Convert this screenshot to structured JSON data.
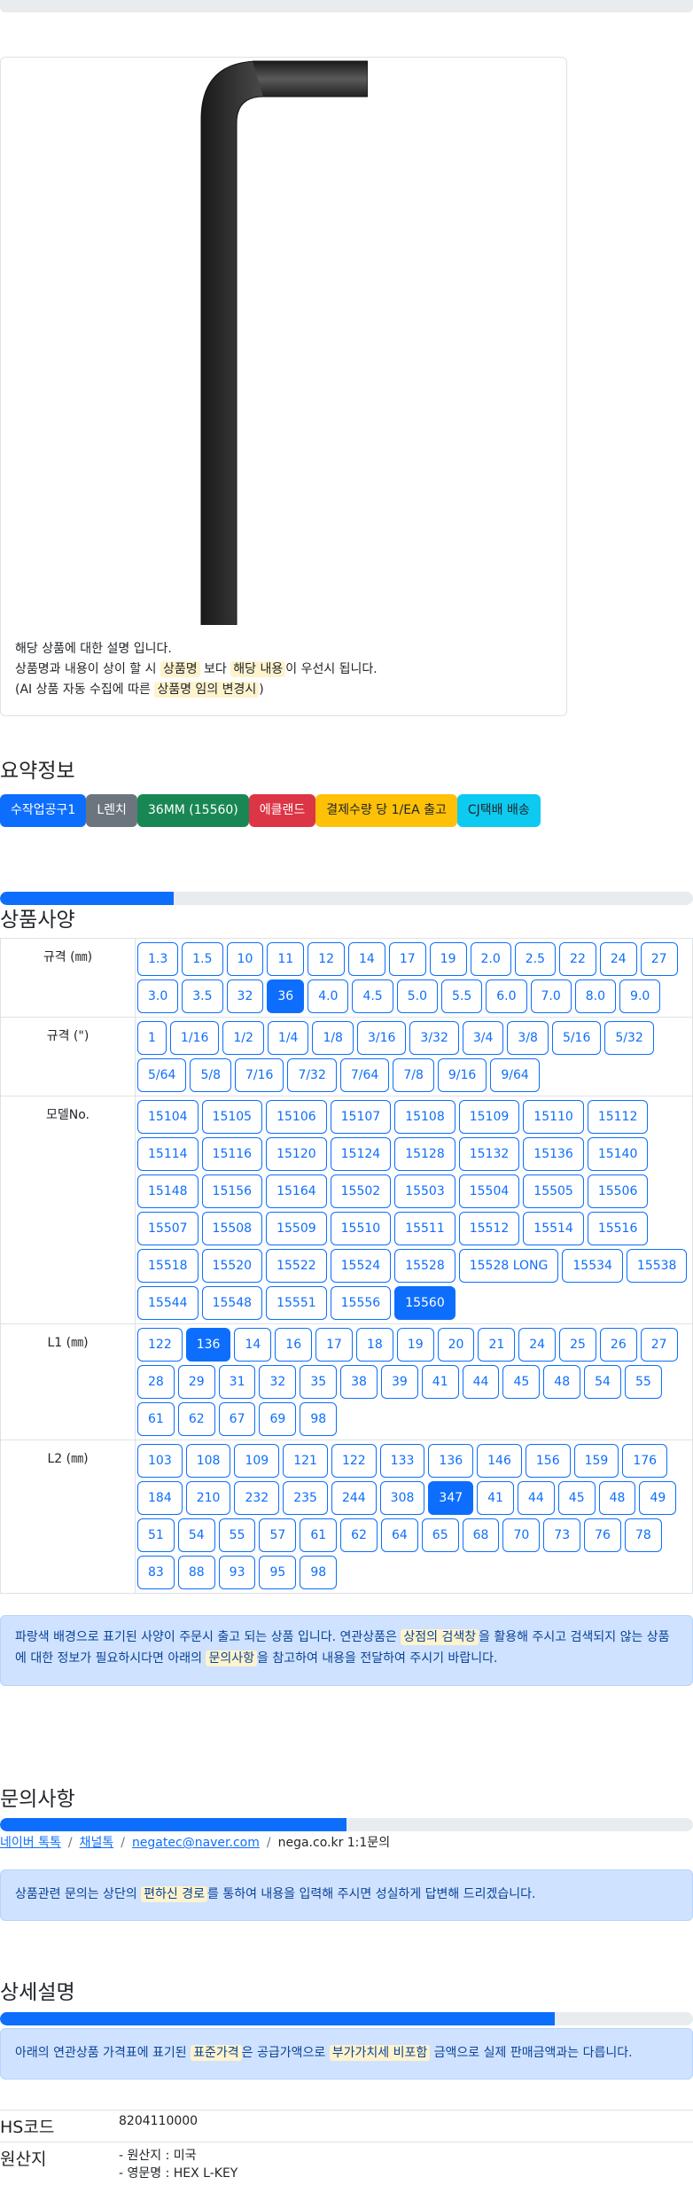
{
  "description": {
    "line1": "해당 상품에 대한 설명 입니다.",
    "line2_a": "상품명과 내용이 상이 할 시 ",
    "line2_hl1": "상품명",
    "line2_b": " 보다 ",
    "line2_hl2": "해당 내용",
    "line2_c": "이 우선시 됩니다.",
    "line3_a": "(AI 상품 자동 수집에 따른 ",
    "line3_hl": "상품명 임의 변경시",
    "line3_b": ")"
  },
  "summary": {
    "title": "요약정보",
    "badges": [
      {
        "label": "수작업공구1",
        "color": "#0d6efd",
        "text": "#ffffff"
      },
      {
        "label": "L렌치",
        "color": "#6c757d",
        "text": "#ffffff"
      },
      {
        "label": "36MM (15560)",
        "color": "#198754",
        "text": "#ffffff"
      },
      {
        "label": "에클랜드",
        "color": "#dc3545",
        "text": "#ffffff"
      },
      {
        "label": "결제수량 당 1/EA 출고",
        "color": "#ffc107",
        "text": "#212529"
      },
      {
        "label": "CJ택배 배송",
        "color": "#0dcaf0",
        "text": "#212529"
      }
    ]
  },
  "specs": {
    "title": "상품사양",
    "progress": 0.25,
    "rows": [
      {
        "label": "규격 (㎜)",
        "options": [
          "1.3",
          "1.5",
          "10",
          "11",
          "12",
          "14",
          "17",
          "19",
          "2.0",
          "2.5",
          "22",
          "24",
          "27",
          "3.0",
          "3.5",
          "32",
          "36",
          "4.0",
          "4.5",
          "5.0",
          "5.5",
          "6.0",
          "7.0",
          "8.0",
          "9.0"
        ],
        "selected": "36"
      },
      {
        "label": "규격 (\")",
        "options": [
          "1",
          "1/16",
          "1/2",
          "1/4",
          "1/8",
          "3/16",
          "3/32",
          "3/4",
          "3/8",
          "5/16",
          "5/32",
          "5/64",
          "5/8",
          "7/16",
          "7/32",
          "7/64",
          "7/8",
          "9/16",
          "9/64"
        ],
        "selected": ""
      },
      {
        "label": "모델No.",
        "options": [
          "15104",
          "15105",
          "15106",
          "15107",
          "15108",
          "15109",
          "15110",
          "15112",
          "15114",
          "15116",
          "15120",
          "15124",
          "15128",
          "15132",
          "15136",
          "15140",
          "15148",
          "15156",
          "15164",
          "15502",
          "15503",
          "15504",
          "15505",
          "15506",
          "15507",
          "15508",
          "15509",
          "15510",
          "15511",
          "15512",
          "15514",
          "15516",
          "15518",
          "15520",
          "15522",
          "15524",
          "15528",
          "15528 LONG",
          "15534",
          "15538",
          "15544",
          "15548",
          "15551",
          "15556",
          "15560"
        ],
        "selected": "15560"
      },
      {
        "label": "L1 (㎜)",
        "options": [
          "122",
          "136",
          "14",
          "16",
          "17",
          "18",
          "19",
          "20",
          "21",
          "24",
          "25",
          "26",
          "27",
          "28",
          "29",
          "31",
          "32",
          "35",
          "38",
          "39",
          "41",
          "44",
          "45",
          "48",
          "54",
          "55",
          "61",
          "62",
          "67",
          "69",
          "98"
        ],
        "selected": "136"
      },
      {
        "label": "L2 (㎜)",
        "options": [
          "103",
          "108",
          "109",
          "121",
          "122",
          "133",
          "136",
          "146",
          "156",
          "159",
          "176",
          "184",
          "210",
          "232",
          "235",
          "244",
          "308",
          "347",
          "41",
          "44",
          "45",
          "48",
          "49",
          "51",
          "54",
          "55",
          "57",
          "61",
          "62",
          "64",
          "65",
          "68",
          "70",
          "73",
          "76",
          "78",
          "83",
          "88",
          "93",
          "95",
          "98"
        ],
        "selected": "347"
      }
    ],
    "note_a": "파랑색 배경으로 표기된 사양이 주문시 출고 되는 상품 입니다. 연관상품은 ",
    "note_hl1": "상점의 검색창",
    "note_b": "을 활용해 주시고 검색되지 않는 상품에 대한 정보가 필요하시다면 아래의 ",
    "note_hl2": "문의사항",
    "note_c": "을 참고하여 내용을 전달하여 주시기 바랍니다."
  },
  "inquiry": {
    "title": "문의사항",
    "progress": 0.5,
    "links": [
      "네이버 톡톡",
      "채널톡",
      "negatec@naver.com"
    ],
    "plain": "nega.co.kr 1:1문의",
    "note_a": "상품관련 문의는 상단의 ",
    "note_hl": "편하신 경로",
    "note_b": "를 통하여 내용을 입력해 주시면 성실하게 답변해 드리겠습니다."
  },
  "detail": {
    "title": "상세설명",
    "progress": 0.8,
    "note_a": "아래의 연관상품 가격표에 표기된 ",
    "note_hl1": "표준가격",
    "note_b": "은 공급가액으로 ",
    "note_hl2": "부가가치세 비포함",
    "note_c": " 금액으로 실제 판매금액과는 다릅니다."
  },
  "info": {
    "hs_label": "HS코드",
    "hs_value": "8204110000",
    "origin_label": "원산지",
    "origin_line1": "- 원산지 : 미국",
    "origin_line2": "- 영문명 : HEX L-KEY"
  }
}
